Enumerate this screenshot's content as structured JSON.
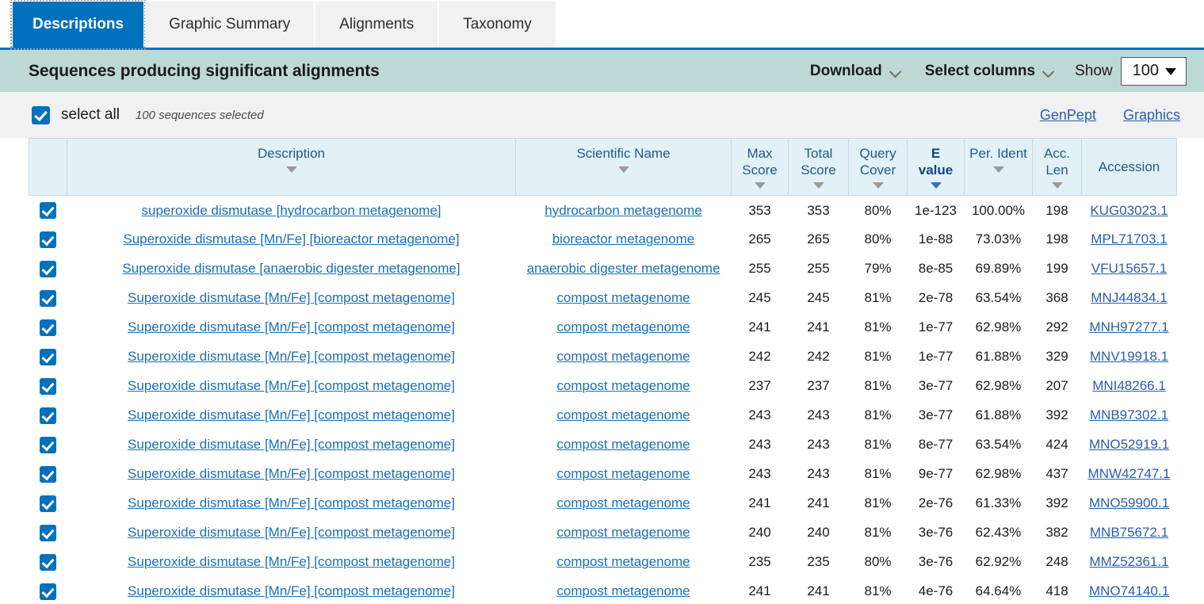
{
  "tabs": [
    {
      "label": "Descriptions",
      "active": true
    },
    {
      "label": "Graphic Summary",
      "active": false
    },
    {
      "label": "Alignments",
      "active": false
    },
    {
      "label": "Taxonomy",
      "active": false
    }
  ],
  "header": {
    "title": "Sequences producing significant alignments",
    "download_label": "Download",
    "select_columns_label": "Select columns",
    "show_label": "Show",
    "show_value": "100"
  },
  "selectbar": {
    "select_all_label": "select all",
    "sequences_selected": "100 sequences selected",
    "genpept_label": "GenPept",
    "graphics_label": "Graphics"
  },
  "columns": [
    {
      "key": "checkbox",
      "label": "",
      "sortable": false,
      "sorted": false
    },
    {
      "key": "description",
      "label": "Description",
      "sortable": true,
      "sorted": false
    },
    {
      "key": "scientific",
      "label": "Scientific Name",
      "sortable": true,
      "sorted": false
    },
    {
      "key": "max_score",
      "label": "Max Score",
      "sortable": true,
      "sorted": false
    },
    {
      "key": "total_score",
      "label": "Total Score",
      "sortable": true,
      "sorted": false
    },
    {
      "key": "query_cover",
      "label": "Query Cover",
      "sortable": true,
      "sorted": false
    },
    {
      "key": "e_value",
      "label": "E value",
      "sortable": true,
      "sorted": true
    },
    {
      "key": "per_ident",
      "label": "Per. Ident",
      "sortable": true,
      "sorted": false
    },
    {
      "key": "acc_len",
      "label": "Acc. Len",
      "sortable": true,
      "sorted": false
    },
    {
      "key": "accession",
      "label": "Accession",
      "sortable": false,
      "sorted": false
    }
  ],
  "column_labels": {
    "description": "Description",
    "scientific": "Scientific Name",
    "max_score_1": "Max",
    "max_score_2": "Score",
    "total_score_1": "Total",
    "total_score_2": "Score",
    "query_cover_1": "Query",
    "query_cover_2": "Cover",
    "e_value_1": "E",
    "e_value_2": "value",
    "per_ident": "Per. Ident",
    "acc_len_1": "Acc.",
    "acc_len_2": "Len",
    "accession": "Accession"
  },
  "colors": {
    "accent_blue": "#0071bc",
    "title_bar": "#bdd9d3",
    "table_header": "#e2f0f7",
    "link_blue": "#1a6fb5",
    "sorted_blue": "#13447e"
  },
  "rows": [
    {
      "checked": true,
      "description": "superoxide dismutase [hydrocarbon metagenome]",
      "scientific": "hydrocarbon metagenome",
      "max_score": "353",
      "total_score": "353",
      "query_cover": "80%",
      "e_value": "1e-123",
      "per_ident": "100.00%",
      "acc_len": "198",
      "accession": "KUG03023.1"
    },
    {
      "checked": true,
      "description": "Superoxide dismutase [Mn/Fe] [bioreactor metagenome]",
      "scientific": "bioreactor metagenome",
      "max_score": "265",
      "total_score": "265",
      "query_cover": "80%",
      "e_value": "1e-88",
      "per_ident": "73.03%",
      "acc_len": "198",
      "accession": "MPL71703.1"
    },
    {
      "checked": true,
      "description": "Superoxide dismutase [anaerobic digester metagenome]",
      "scientific": "anaerobic digester metagenome",
      "max_score": "255",
      "total_score": "255",
      "query_cover": "79%",
      "e_value": "8e-85",
      "per_ident": "69.89%",
      "acc_len": "199",
      "accession": "VFU15657.1"
    },
    {
      "checked": true,
      "description": "Superoxide dismutase [Mn/Fe] [compost metagenome]",
      "scientific": "compost metagenome",
      "max_score": "245",
      "total_score": "245",
      "query_cover": "81%",
      "e_value": "2e-78",
      "per_ident": "63.54%",
      "acc_len": "368",
      "accession": "MNJ44834.1"
    },
    {
      "checked": true,
      "description": "Superoxide dismutase [Mn/Fe] [compost metagenome]",
      "scientific": "compost metagenome",
      "max_score": "241",
      "total_score": "241",
      "query_cover": "81%",
      "e_value": "1e-77",
      "per_ident": "62.98%",
      "acc_len": "292",
      "accession": "MNH97277.1"
    },
    {
      "checked": true,
      "description": "Superoxide dismutase [Mn/Fe] [compost metagenome]",
      "scientific": "compost metagenome",
      "max_score": "242",
      "total_score": "242",
      "query_cover": "81%",
      "e_value": "1e-77",
      "per_ident": "61.88%",
      "acc_len": "329",
      "accession": "MNV19918.1"
    },
    {
      "checked": true,
      "description": "Superoxide dismutase [Mn/Fe] [compost metagenome]",
      "scientific": "compost metagenome",
      "max_score": "237",
      "total_score": "237",
      "query_cover": "81%",
      "e_value": "3e-77",
      "per_ident": "62.98%",
      "acc_len": "207",
      "accession": "MNI48266.1"
    },
    {
      "checked": true,
      "description": "Superoxide dismutase [Mn/Fe] [compost metagenome]",
      "scientific": "compost metagenome",
      "max_score": "243",
      "total_score": "243",
      "query_cover": "81%",
      "e_value": "3e-77",
      "per_ident": "61.88%",
      "acc_len": "392",
      "accession": "MNB97302.1"
    },
    {
      "checked": true,
      "description": "Superoxide dismutase [Mn/Fe] [compost metagenome]",
      "scientific": "compost metagenome",
      "max_score": "243",
      "total_score": "243",
      "query_cover": "81%",
      "e_value": "8e-77",
      "per_ident": "63.54%",
      "acc_len": "424",
      "accession": "MNO52919.1"
    },
    {
      "checked": true,
      "description": "Superoxide dismutase [Mn/Fe] [compost metagenome]",
      "scientific": "compost metagenome",
      "max_score": "243",
      "total_score": "243",
      "query_cover": "81%",
      "e_value": "9e-77",
      "per_ident": "62.98%",
      "acc_len": "437",
      "accession": "MNW42747.1"
    },
    {
      "checked": true,
      "description": "Superoxide dismutase [Mn/Fe] [compost metagenome]",
      "scientific": "compost metagenome",
      "max_score": "241",
      "total_score": "241",
      "query_cover": "81%",
      "e_value": "2e-76",
      "per_ident": "61.33%",
      "acc_len": "392",
      "accession": "MNO59900.1"
    },
    {
      "checked": true,
      "description": "Superoxide dismutase [Mn/Fe] [compost metagenome]",
      "scientific": "compost metagenome",
      "max_score": "240",
      "total_score": "240",
      "query_cover": "81%",
      "e_value": "3e-76",
      "per_ident": "62.43%",
      "acc_len": "382",
      "accession": "MNB75672.1"
    },
    {
      "checked": true,
      "description": "Superoxide dismutase [Mn/Fe] [compost metagenome]",
      "scientific": "compost metagenome",
      "max_score": "235",
      "total_score": "235",
      "query_cover": "80%",
      "e_value": "3e-76",
      "per_ident": "62.92%",
      "acc_len": "248",
      "accession": "MMZ52361.1"
    },
    {
      "checked": true,
      "description": "Superoxide dismutase [Mn/Fe] [compost metagenome]",
      "scientific": "compost metagenome",
      "max_score": "241",
      "total_score": "241",
      "query_cover": "81%",
      "e_value": "4e-76",
      "per_ident": "64.64%",
      "acc_len": "418",
      "accession": "MNO74140.1"
    }
  ]
}
